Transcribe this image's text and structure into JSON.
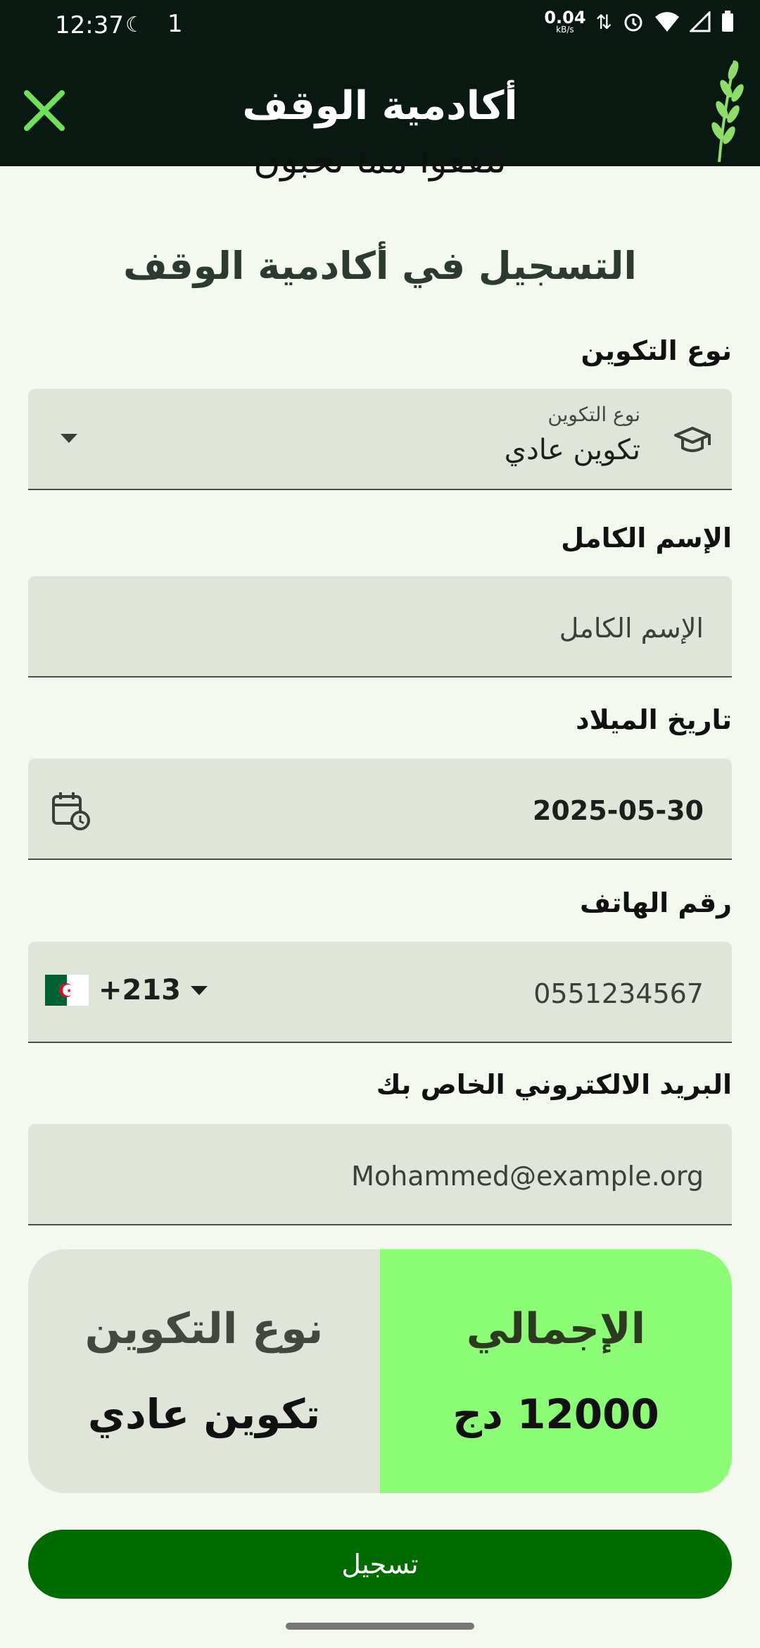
{
  "status_bar": {
    "time": "12:37",
    "notification": "1",
    "speed": "0.04",
    "speed_unit": "kB/s"
  },
  "app_bar": {
    "title": "أكادمية الوقف"
  },
  "verse": "تنفقوا مما تحبون",
  "form": {
    "title": "التسجيل في أكادمية الوقف",
    "training_type": {
      "label": "نوع التكوين",
      "floating_label": "نوع التكوين",
      "selected": "تكوين عادي"
    },
    "full_name": {
      "label": "الإسم الكامل",
      "placeholder": "الإسم الكامل"
    },
    "birth_date": {
      "label": "تاريخ الميلاد",
      "value": "2025-05-30"
    },
    "phone": {
      "label": "رقم الهاتف",
      "dial_code": "+213",
      "placeholder": "0551234567"
    },
    "email": {
      "label": "البريد الالكتروني الخاص بك",
      "placeholder": "Mohammed@example.org"
    }
  },
  "summary": {
    "type_header": "نوع التكوين",
    "type_value": "تكوين عادي",
    "total_header": "الإجمالي",
    "total_value": "12000 دج"
  },
  "submit_label": "تسجيل",
  "colors": {
    "app_bar_bg": "#0a1812",
    "close_icon": "#6ee05a",
    "total_bg": "#8cfb76",
    "submit_bg": "#006b00",
    "field_bg": "#e0e5d9"
  },
  "icons": {
    "close": "close-icon",
    "logo": "wheat-icon",
    "training_type": "graduation-cap-icon",
    "date": "calendar-clock-icon",
    "country_flag": "algeria-flag-icon"
  }
}
